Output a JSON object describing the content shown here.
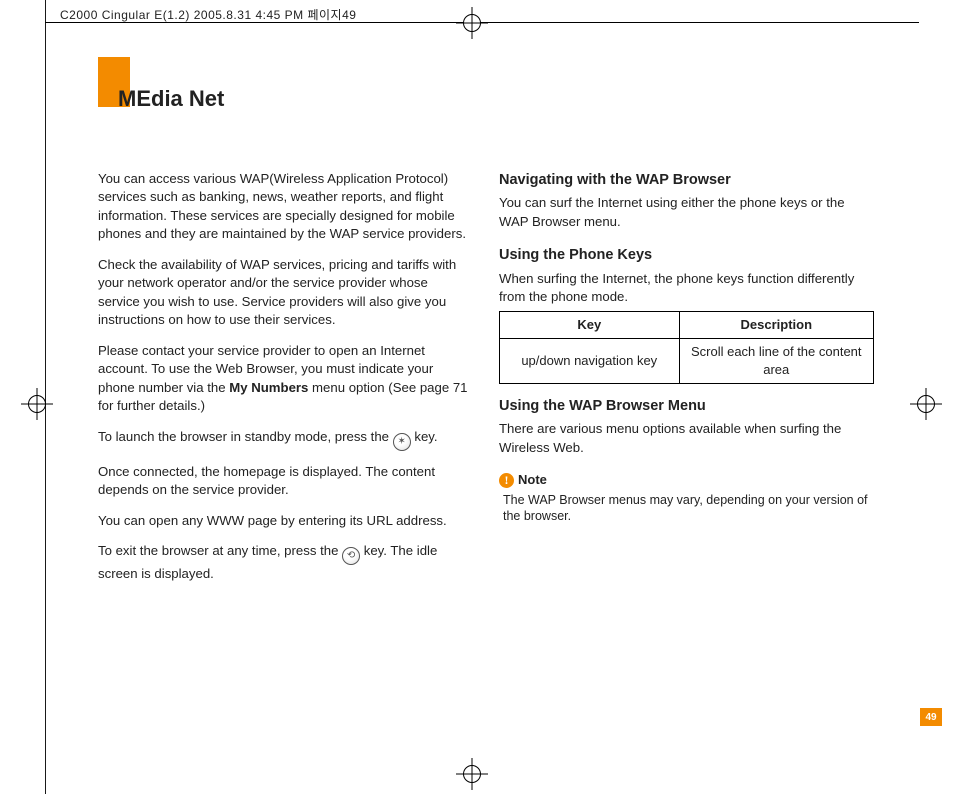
{
  "header_meta": "C2000 Cingular E(1.2)  2005.8.31 4:45 PM 페이지49",
  "title": "MEdia Net",
  "page_number": "49",
  "left_column": {
    "p1": "You can access various WAP(Wireless Application Protocol) services such as banking, news, weather reports, and flight information. These services are specially designed for mobile phones and they are maintained by the WAP service providers.",
    "p2": "Check the availability of WAP services, pricing and tariffs with your network operator and/or the service provider whose service you wish to use. Service providers will also give you instructions on how to use their services.",
    "p3a": "Please contact your service provider to open an Internet account. To use the Web Browser, you must indicate your phone number via the ",
    "p3b_bold": "My Numbers",
    "p3c": " menu option (See page 71 for further details.)",
    "p4a": "To launch the browser in standby mode, press the ",
    "p4b": " key.",
    "p5": "Once connected, the homepage is displayed. The content depends on the service provider.",
    "p6": "You can open any WWW page by entering its URL address.",
    "p7a": "To exit the browser at any time, press the ",
    "p7b": " key. The idle screen is displayed."
  },
  "right_column": {
    "h1": "Navigating with the WAP Browser",
    "h1_body": "You can surf the Internet using either the phone keys or the WAP Browser menu.",
    "h2": "Using the Phone Keys",
    "h2_body": "When surfing the Internet, the phone keys function differently from the phone mode.",
    "table": {
      "head_key": "Key",
      "head_desc": "Description",
      "row_key": "up/down navigation key",
      "row_desc": "Scroll each line of the content area"
    },
    "h3": "Using the WAP Browser Menu",
    "h3_body": "There are various menu options available when surfing the Wireless Web.",
    "note_label": "Note",
    "note_body": "The WAP Browser menus may vary, depending on your version of the browser."
  }
}
